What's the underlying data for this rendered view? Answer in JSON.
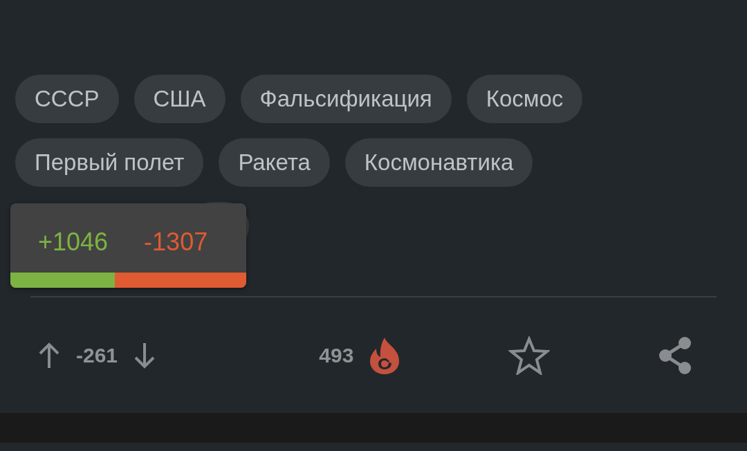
{
  "tags": [
    {
      "label": "СССР"
    },
    {
      "label": "США"
    },
    {
      "label": "Фальсификация"
    },
    {
      "label": "Космос"
    },
    {
      "label": "Первый полет"
    },
    {
      "label": "Ракета"
    },
    {
      "label": "Космонавтика"
    }
  ],
  "vote_popup": {
    "pluses": "+1046",
    "minuses": "-1307",
    "level": 0.444
  },
  "actions": {
    "rating": "-261",
    "hot_count": "493"
  }
}
